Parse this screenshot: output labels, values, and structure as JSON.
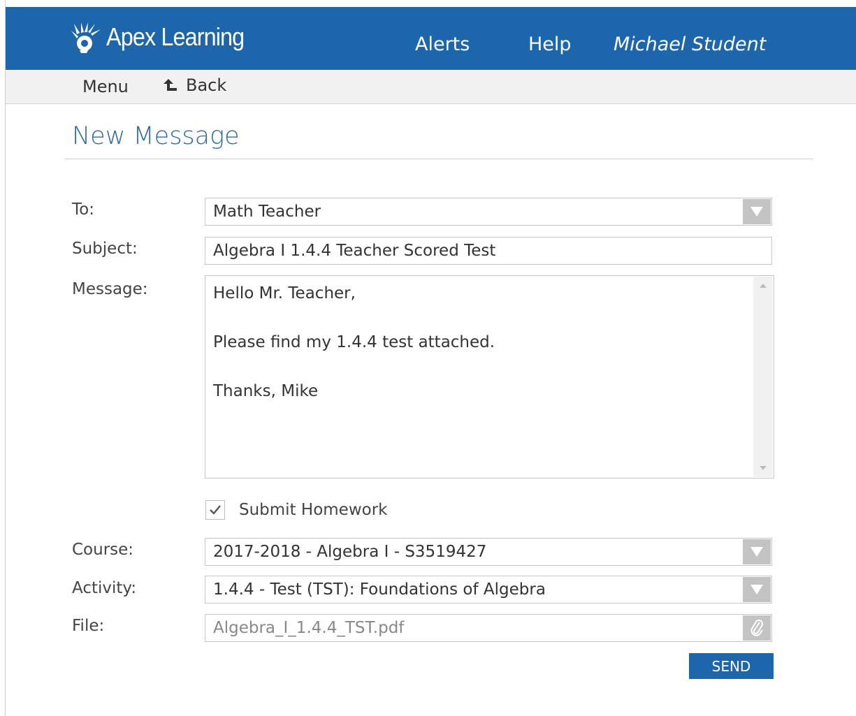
{
  "header": {
    "logo_text": "Apex Learning",
    "nav": {
      "alerts": "Alerts",
      "help": "Help",
      "user": "Michael Student"
    }
  },
  "subnav": {
    "menu": "Menu",
    "back": "Back"
  },
  "page": {
    "title": "New Message"
  },
  "form": {
    "to": {
      "label": "To:",
      "value": "Math Teacher"
    },
    "subject": {
      "label": "Subject:",
      "value": "Algebra I 1.4.4 Teacher Scored Test"
    },
    "message": {
      "label": "Message:",
      "lines": [
        "Hello Mr. Teacher,",
        "Please find my 1.4.4 test attached.",
        "Thanks, Mike"
      ]
    },
    "submit_homework": {
      "label": "Submit Homework",
      "checked": true
    },
    "course": {
      "label": "Course:",
      "value": "2017-2018 - Algebra I - S3519427"
    },
    "activity": {
      "label": "Activity:",
      "value": "1.4.4 - Test (TST): Foundations of Algebra"
    },
    "file": {
      "label": "File:",
      "value": "Algebra_I_1.4.4_TST.pdf"
    },
    "send_label": "SEND"
  },
  "icons": {
    "logo": "apex-logo-icon",
    "back": "back-arrow-icon",
    "dropdown": "dropdown-triangle-icon",
    "checkmark": "checkmark-icon",
    "attach": "paperclip-icon"
  },
  "colors": {
    "brand": "#1e66ab",
    "title": "#2e6ba5",
    "subbar": "#f1f1f1"
  }
}
